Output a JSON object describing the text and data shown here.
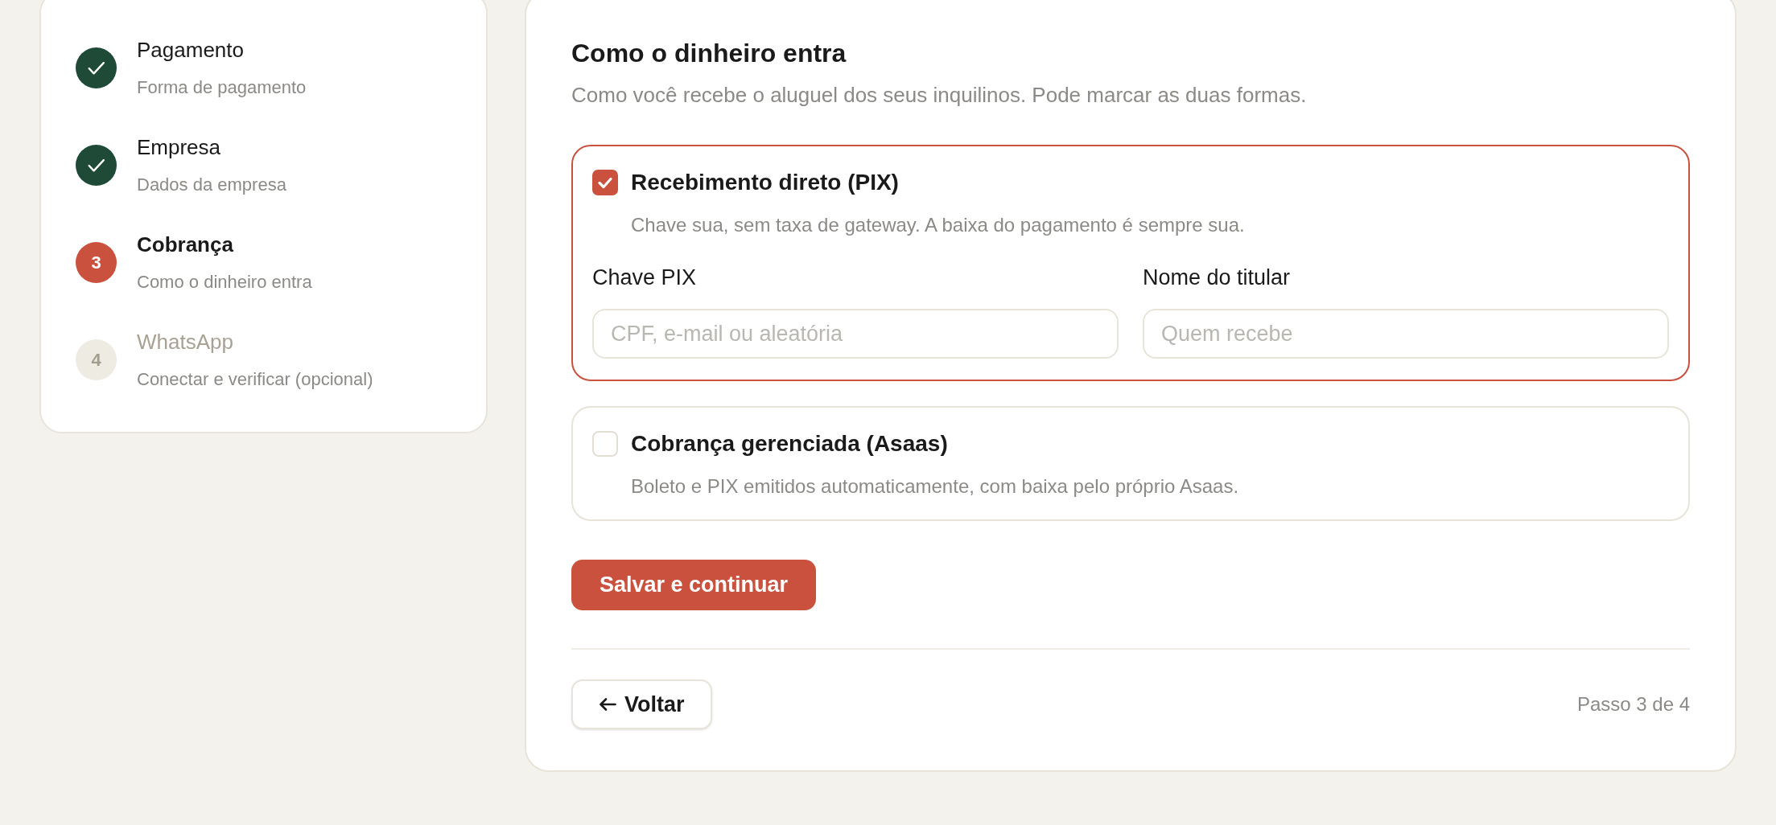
{
  "steps": [
    {
      "title": "Pagamento",
      "subtitle": "Forma de pagamento",
      "completed": true,
      "selected": false
    },
    {
      "title": "Empresa",
      "subtitle": "Dados da empresa",
      "completed": true,
      "selected": false
    },
    {
      "number": "3",
      "title": "Cobrança",
      "subtitle": "Como o dinheiro entra",
      "completed": false,
      "selected": true
    },
    {
      "number": "4",
      "title": "WhatsApp",
      "subtitle": "Conectar e verificar (opcional)",
      "completed": false,
      "selected": false
    }
  ],
  "form": {
    "title": "Como o dinheiro entra",
    "description": "Como você recebe o aluguel dos seus inquilinos. Pode marcar as duas formas.",
    "options": [
      {
        "title": "Recebimento direto (PIX)",
        "description": "Chave sua, sem taxa de gateway. A baixa do pagamento é sempre sua.",
        "checked": true,
        "fields": [
          {
            "label": "Chave PIX",
            "placeholder": "CPF, e-mail ou aleatória"
          },
          {
            "label": "Nome do titular",
            "placeholder": "Quem recebe"
          }
        ]
      },
      {
        "title": "Cobrança gerenciada (Asaas)",
        "description": "Boleto e PIX emitidos automaticamente, com baixa pelo próprio Asaas.",
        "checked": false
      }
    ],
    "primary_button": "Salvar e continuar",
    "back_button": "Voltar",
    "step_counter": "Passo 3 de 4"
  }
}
